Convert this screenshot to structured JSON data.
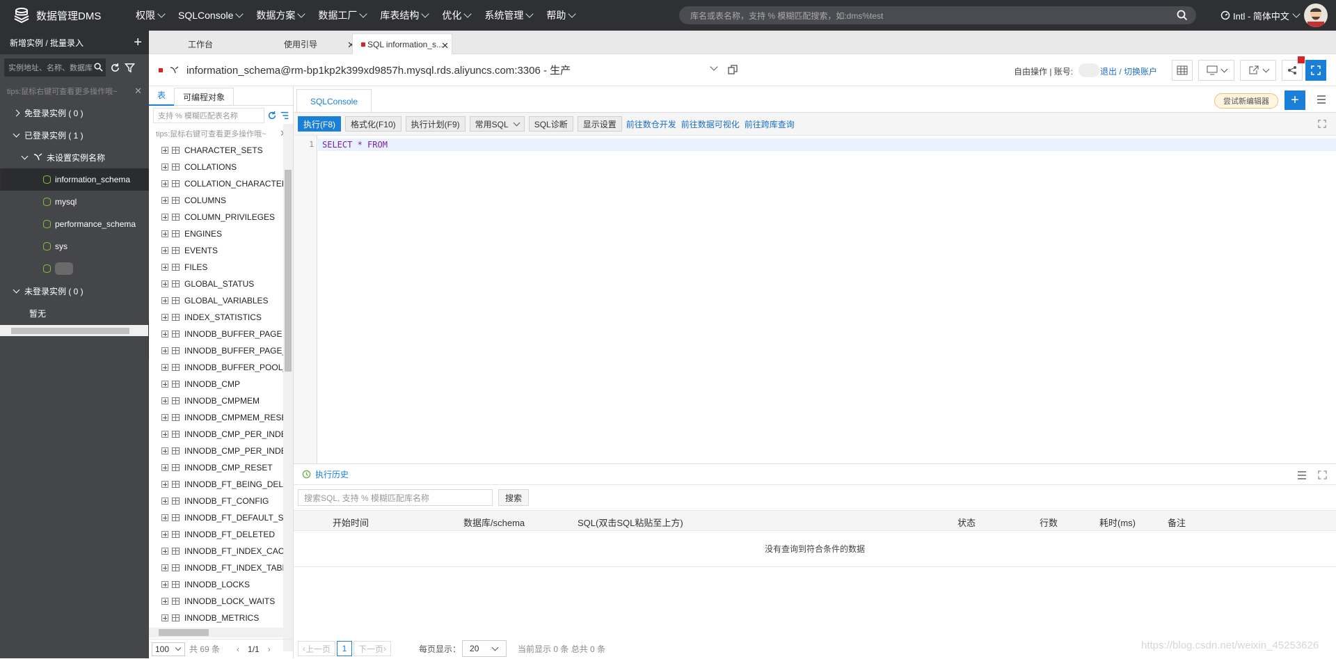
{
  "app": {
    "name": "数据管理DMS"
  },
  "topnav": {
    "items": [
      "权限",
      "SQLConsole",
      "数据方案",
      "数据工厂",
      "库表结构",
      "优化",
      "系统管理",
      "帮助"
    ],
    "search_placeholder": "库名或表名称，支持 % 模糊匹配搜索，如:dms%test",
    "lang": "Intl - 简体中文"
  },
  "sidebar": {
    "header": "新增实例 / 批量录入",
    "search_placeholder": "实例地址、名称、数据库",
    "tips": "tips:鼠标右键可查看更多操作哦~",
    "groups": [
      {
        "label": "免登录实例 ( 0 )"
      },
      {
        "label": "已登录实例 ( 1 )"
      },
      {
        "label": "未登录实例 ( 0 )"
      }
    ],
    "instance": "未设置实例名称",
    "dbs": [
      "information_schema",
      "mysql",
      "performance_schema",
      "sys"
    ],
    "empty": "暂无"
  },
  "tabs": [
    {
      "label": "工作台"
    },
    {
      "label": "使用引导"
    },
    {
      "label": "SQL information_s..."
    }
  ],
  "connection": {
    "title": "information_schema@rm-bp1kp2k399xd9857h.mysql.rds.aliyuncs.com:3306 - 生产",
    "mode": "自由操作 | 账号:",
    "logout": "退出 / 切换账户"
  },
  "objects": {
    "tabs": [
      "表",
      "可编程对象"
    ],
    "search_placeholder": "支持 % 模糊匹配表名称",
    "tips": "tips:鼠标右键可查看更多操作哦~",
    "tables": [
      "CHARACTER_SETS",
      "COLLATIONS",
      "COLLATION_CHARACTER_SET_APPLICABILITY",
      "COLUMNS",
      "COLUMN_PRIVILEGES",
      "ENGINES",
      "EVENTS",
      "FILES",
      "GLOBAL_STATUS",
      "GLOBAL_VARIABLES",
      "INDEX_STATISTICS",
      "INNODB_BUFFER_PAGE",
      "INNODB_BUFFER_PAGE_LRU",
      "INNODB_BUFFER_POOL_STATS",
      "INNODB_CMP",
      "INNODB_CMPMEM",
      "INNODB_CMPMEM_RESET",
      "INNODB_CMP_PER_INDEX",
      "INNODB_CMP_PER_INDEX_RESET",
      "INNODB_CMP_RESET",
      "INNODB_FT_BEING_DELETED",
      "INNODB_FT_CONFIG",
      "INNODB_FT_DEFAULT_STOPWORD",
      "INNODB_FT_DELETED",
      "INNODB_FT_INDEX_CACHE",
      "INNODB_FT_INDEX_TABLE",
      "INNODB_LOCKS",
      "INNODB_LOCK_WAITS",
      "INNODB_METRICS"
    ],
    "page_size": "100",
    "total": "共 69 条",
    "page": "1/1"
  },
  "editor": {
    "tab": "SQLConsole",
    "try_new": "尝试新编辑器",
    "buttons": [
      "执行(F8)",
      "格式化(F10)",
      "执行计划(F9)",
      "常用SQL",
      "SQL诊断",
      "显示设置"
    ],
    "links": [
      "前往数仓开发",
      "前往数据可视化",
      "前往跨库查询"
    ],
    "line_no": "1",
    "code": "SELECT * FROM"
  },
  "history": {
    "title": "执行历史",
    "search_placeholder": "搜索SQL, 支持 % 模糊匹配库名称",
    "search_btn": "搜索",
    "columns": [
      "开始时间",
      "数据库/schema",
      "SQL(双击SQL粘贴至上方)",
      "状态",
      "行数",
      "耗时(ms)",
      "备注"
    ],
    "empty": "没有查询到符合条件的数据",
    "prev": "上一页",
    "page": "1",
    "next": "下一页",
    "per_page_label": "每页显示：",
    "per_page": "20",
    "summary": "当前显示 0 条 总共 0 条"
  },
  "watermark": "https://blog.csdn.net/weixin_45253626"
}
